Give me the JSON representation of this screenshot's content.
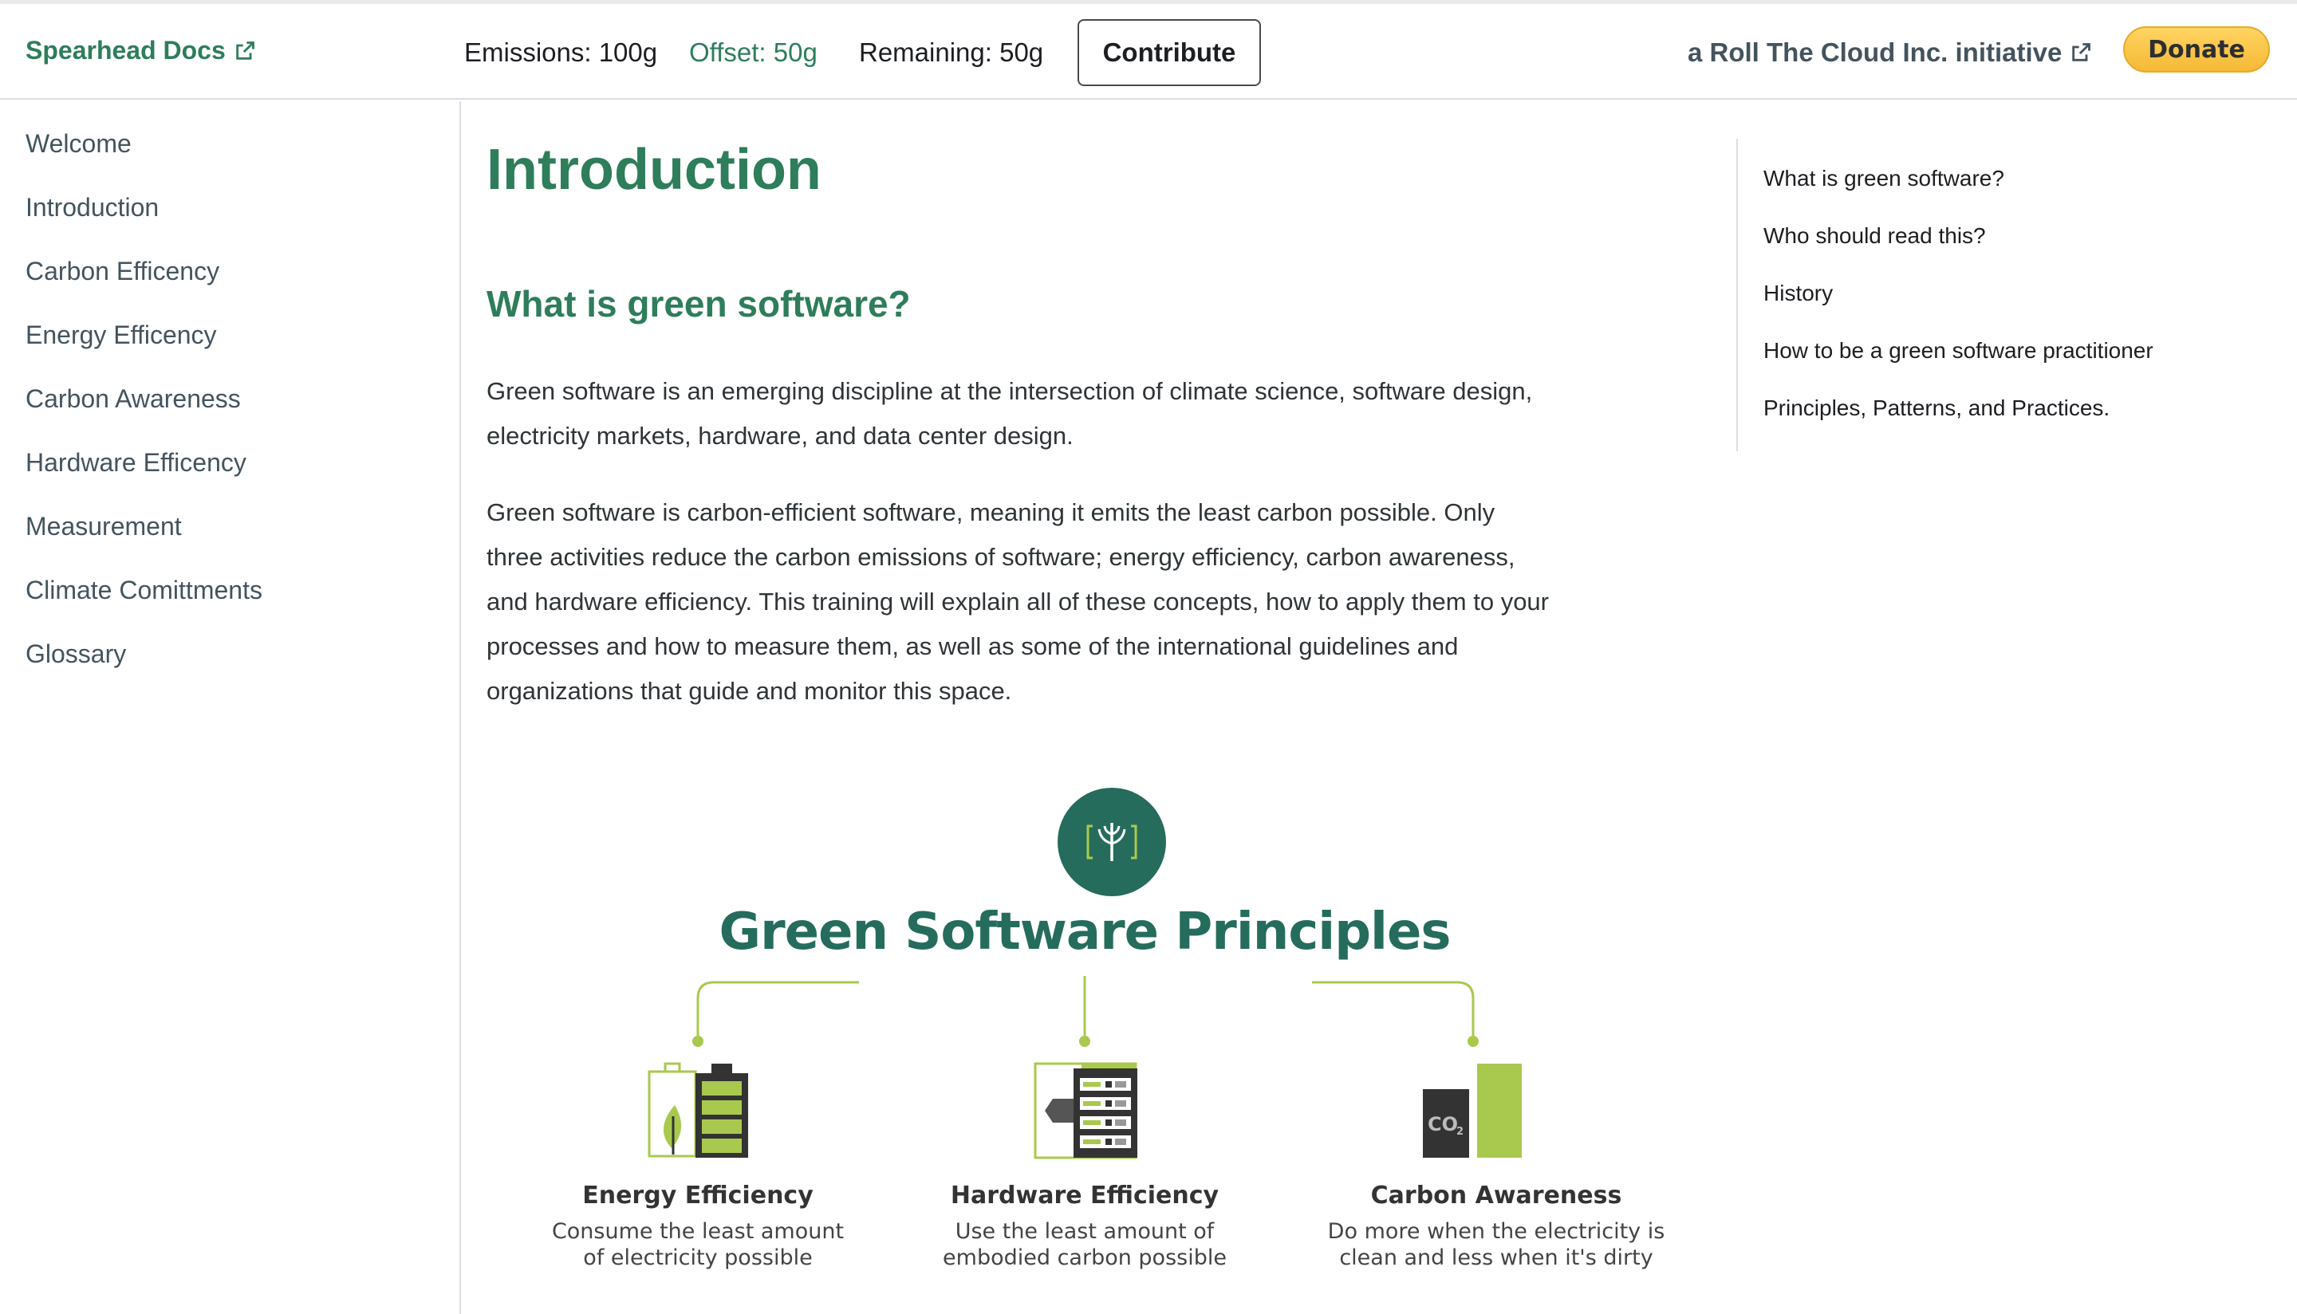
{
  "navbar": {
    "brand": "Spearhead Docs",
    "emissions": "Emissions: 100g",
    "offset": "Offset: 50g",
    "remaining": "Remaining: 50g",
    "contribute_label": "Contribute",
    "initiative": "a Roll The Cloud Inc. initiative",
    "donate_label": "Donate"
  },
  "sidebar": {
    "items": [
      {
        "label": "Welcome"
      },
      {
        "label": "Introduction"
      },
      {
        "label": "Carbon Efficency"
      },
      {
        "label": "Energy Efficency"
      },
      {
        "label": "Carbon Awareness"
      },
      {
        "label": "Hardware Efficency"
      },
      {
        "label": "Measurement"
      },
      {
        "label": "Climate Comittments"
      },
      {
        "label": "Glossary"
      }
    ]
  },
  "main": {
    "title": "Introduction",
    "section_heading": "What is green software?",
    "paragraphs": [
      "Green software is an emerging discipline at the intersection of climate science, software design, electricity markets, hardware, and data center design.",
      "Green software is carbon-efficient software, meaning it emits the least carbon possible. Only three activities reduce the carbon emissions of software; energy efficiency, carbon awareness, and hardware efficiency. This training will explain all of these concepts, how to apply them to your processes and how to measure them, as well as some of the international guidelines and organizations that guide and monitor this space."
    ]
  },
  "toc": {
    "items": [
      {
        "label": "What is green software?"
      },
      {
        "label": "Who should read this?"
      },
      {
        "label": "History"
      },
      {
        "label": "How to be a green software practitioner"
      },
      {
        "label": "Principles, Patterns, and Practices."
      }
    ]
  },
  "infographic": {
    "title": "Green Software Principles",
    "co2_label": "CO",
    "co2_sub": "2",
    "principles": [
      {
        "title": "Energy Efficiency",
        "desc_line1": "Consume the least amount",
        "desc_line2": "of electricity possible"
      },
      {
        "title": "Hardware Efficiency",
        "desc_line1": "Use the least amount of",
        "desc_line2": "embodied carbon possible"
      },
      {
        "title": "Carbon Awareness",
        "desc_line1": "Do more when the electricity is",
        "desc_line2": "clean and less when it's dirty"
      }
    ],
    "colors": {
      "teal": "#256c5c",
      "lime": "#a9c94e",
      "dark": "#333333"
    }
  }
}
